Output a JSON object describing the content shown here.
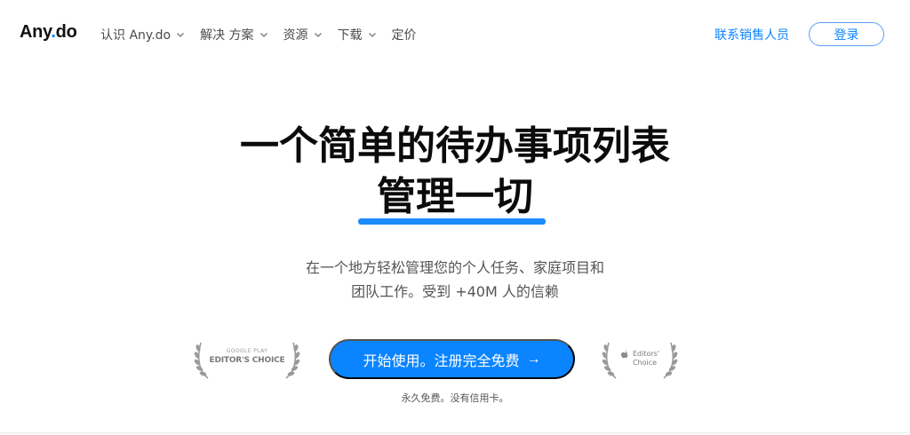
{
  "nav": {
    "logo_prefix": "Any",
    "logo_dot": ".",
    "logo_suffix": "do",
    "menu": [
      {
        "label": "认识 Any.do"
      },
      {
        "label": "解决 方案"
      },
      {
        "label": "资源"
      },
      {
        "label": "下载"
      },
      {
        "label": "定价"
      }
    ],
    "contact_label": "联系销售人员",
    "login_label": "登录"
  },
  "hero": {
    "title_line1": "一个简单的待办事项列表",
    "title_line2": "管理一切",
    "subtitle_line1": "在一个地方轻松管理您的个人任务、家庭项目和",
    "subtitle_line2": "团队工作。受到 +40M 人的信赖"
  },
  "cta": {
    "label": "开始使用。注册完全免费",
    "arrow": "→",
    "note": "永久免费。没有信用卡。"
  },
  "badges": {
    "google_small": "GOOGLE PLAY",
    "google_big": "EDITOR'S CHOICE",
    "apple_line1": "Editors'",
    "apple_line2": "Choice"
  },
  "colors": {
    "accent": "#0a84ff",
    "underline": "#1c8cff",
    "title": "#0b0b0b"
  }
}
